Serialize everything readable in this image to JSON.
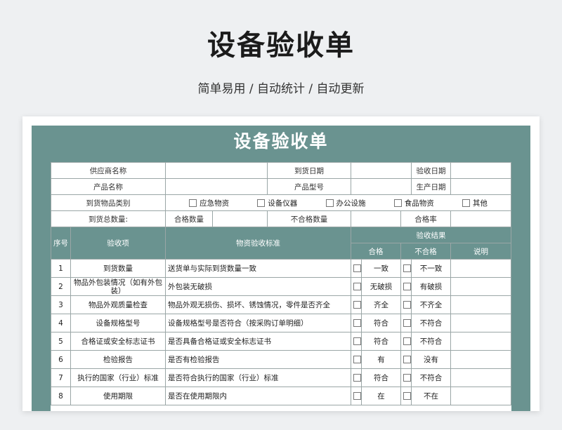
{
  "hero": {
    "title": "设备验收单",
    "subtitle": "简单易用 / 自动统计 / 自动更新"
  },
  "form": {
    "title": "设备验收单",
    "row1": {
      "supplier_label": "供应商名称",
      "arrival_date_label": "到货日期",
      "acceptance_date_label": "验收日期"
    },
    "row2": {
      "product_name_label": "产品名称",
      "model_label": "产品型号",
      "production_date_label": "生产日期"
    },
    "row3": {
      "category_label": "到货物品类别",
      "options": [
        "应急物资",
        "设备仪器",
        "办公设施",
        "食品物资",
        "其他"
      ]
    },
    "row4": {
      "total_label": "到货总数量:",
      "qualified_label": "合格数量",
      "unqualified_label": "不合格数量",
      "rate_label": "合格率"
    },
    "headers": {
      "no": "序号",
      "item": "验收项",
      "standard": "物资验收标准",
      "result": "验收结果",
      "pass": "合格",
      "fail": "不合格",
      "note": "说明"
    },
    "items": [
      {
        "no": "1",
        "item": "到货数量",
        "standard": "送货单与实际到货数量一致",
        "pass": "一致",
        "fail": "不一致"
      },
      {
        "no": "2",
        "item": "物品外包装情况（如有外包装）",
        "standard": "外包装无破损",
        "pass": "无破损",
        "fail": "有破损"
      },
      {
        "no": "3",
        "item": "物品外观质量检查",
        "standard": "物品外观无损伤、损坏、锈蚀情况，零件是否齐全",
        "pass": "齐全",
        "fail": "不齐全"
      },
      {
        "no": "4",
        "item": "设备规格型号",
        "standard": "设备规格型号是否符合（按采购订单明细）",
        "pass": "符合",
        "fail": "不符合"
      },
      {
        "no": "5",
        "item": "合格证或安全标志证书",
        "standard": "是否具备合格证或安全标志证书",
        "pass": "符合",
        "fail": "不符合"
      },
      {
        "no": "6",
        "item": "检验报告",
        "standard": "是否有检验报告",
        "pass": "有",
        "fail": "没有"
      },
      {
        "no": "7",
        "item": "执行的国家（行业）标准",
        "standard": "是否符合执行的国家（行业）标准",
        "pass": "符合",
        "fail": "不符合"
      },
      {
        "no": "8",
        "item": "使用期限",
        "standard": "是否在使用期限内",
        "pass": "在",
        "fail": "不在"
      }
    ]
  },
  "colors": {
    "accent": "#6a9390",
    "background": "#eef0f2"
  }
}
